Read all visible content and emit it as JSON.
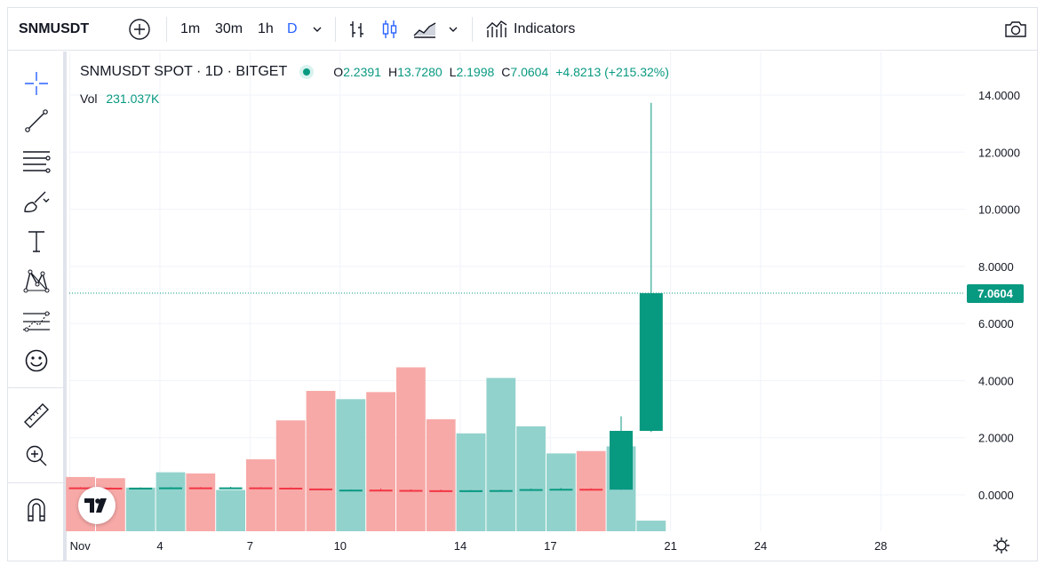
{
  "toolbar": {
    "symbol": "SNMUSDT",
    "intervals": [
      {
        "label": "1m",
        "active": false
      },
      {
        "label": "30m",
        "active": false
      },
      {
        "label": "1h",
        "active": false
      },
      {
        "label": "D",
        "active": true
      }
    ],
    "indicators_label": "Indicators",
    "icons": [
      "plus-circle-icon",
      "chevron-down-icon",
      "bar-style-icon",
      "candle-style-icon",
      "area-style-icon",
      "chevron-down-icon",
      "indicators-icon",
      "camera-icon"
    ]
  },
  "left_toolbar": {
    "tools": [
      "crosshair-icon",
      "trend-line-icon",
      "fib-lines-icon",
      "brush-icon",
      "text-icon",
      "pattern-icon",
      "prediction-icon",
      "emoji-icon",
      "ruler-icon",
      "zoom-in-icon",
      "magnet-icon"
    ]
  },
  "legend": {
    "title": "SNMUSDT SPOT · 1D · BITGET",
    "o_label": "O",
    "o": "2.2391",
    "h_label": "H",
    "h": "13.7280",
    "l_label": "L",
    "l": "2.1998",
    "c_label": "C",
    "c": "7.0604",
    "change": "+4.8213 (+215.32%)",
    "vol_label": "Vol",
    "vol": "231.037K"
  },
  "colors": {
    "up": "#089981",
    "down": "#f23645",
    "vol_up": "#92d2cc",
    "vol_down": "#f7a9a7"
  },
  "last_price_label": "7.0604",
  "chart_data": {
    "type": "candlestick",
    "y_ticks": [
      "14.0000",
      "12.0000",
      "10.0000",
      "8.0000",
      "6.0000",
      "4.0000",
      "2.0000",
      "0.0000"
    ],
    "x_ticks": [
      "Nov",
      "4",
      "7",
      "10",
      "14",
      "17",
      "21",
      "24",
      "28"
    ],
    "ylim": [
      -0.8,
      15.2
    ],
    "candles": [
      {
        "o": 0.26,
        "h": 0.27,
        "l": 0.24,
        "c": 0.25
      },
      {
        "o": 0.25,
        "h": 0.26,
        "l": 0.23,
        "c": 0.24
      },
      {
        "o": 0.24,
        "h": 0.26,
        "l": 0.23,
        "c": 0.25
      },
      {
        "o": 0.25,
        "h": 0.27,
        "l": 0.24,
        "c": 0.26
      },
      {
        "o": 0.26,
        "h": 0.27,
        "l": 0.24,
        "c": 0.25
      },
      {
        "o": 0.25,
        "h": 0.28,
        "l": 0.24,
        "c": 0.26
      },
      {
        "o": 0.26,
        "h": 0.27,
        "l": 0.24,
        "c": 0.25
      },
      {
        "o": 0.25,
        "h": 0.26,
        "l": 0.21,
        "c": 0.22
      },
      {
        "o": 0.22,
        "h": 0.23,
        "l": 0.16,
        "c": 0.17
      },
      {
        "o": 0.17,
        "h": 0.19,
        "l": 0.15,
        "c": 0.18
      },
      {
        "o": 0.18,
        "h": 0.22,
        "l": 0.16,
        "c": 0.17
      },
      {
        "o": 0.17,
        "h": 0.19,
        "l": 0.15,
        "c": 0.16
      },
      {
        "o": 0.16,
        "h": 0.18,
        "l": 0.15,
        "c": 0.155
      },
      {
        "o": 0.155,
        "h": 0.17,
        "l": 0.14,
        "c": 0.16
      },
      {
        "o": 0.16,
        "h": 0.18,
        "l": 0.15,
        "c": 0.165
      },
      {
        "o": 0.165,
        "h": 0.22,
        "l": 0.16,
        "c": 0.2
      },
      {
        "o": 0.2,
        "h": 0.24,
        "l": 0.19,
        "c": 0.21
      },
      {
        "o": 0.21,
        "h": 0.23,
        "l": 0.19,
        "c": 0.2
      },
      {
        "o": 0.18,
        "h": 2.75,
        "l": 0.17,
        "c": 2.24
      },
      {
        "o": 2.2391,
        "h": 13.728,
        "l": 2.1998,
        "c": 7.0604
      }
    ],
    "volume": [
      0.46,
      0.45,
      0.37,
      0.5,
      0.49,
      0.35,
      0.61,
      0.94,
      1.19,
      1.12,
      1.18,
      1.39,
      0.95,
      0.83,
      1.3,
      0.89,
      0.66,
      0.68,
      0.72,
      0.09
    ]
  }
}
